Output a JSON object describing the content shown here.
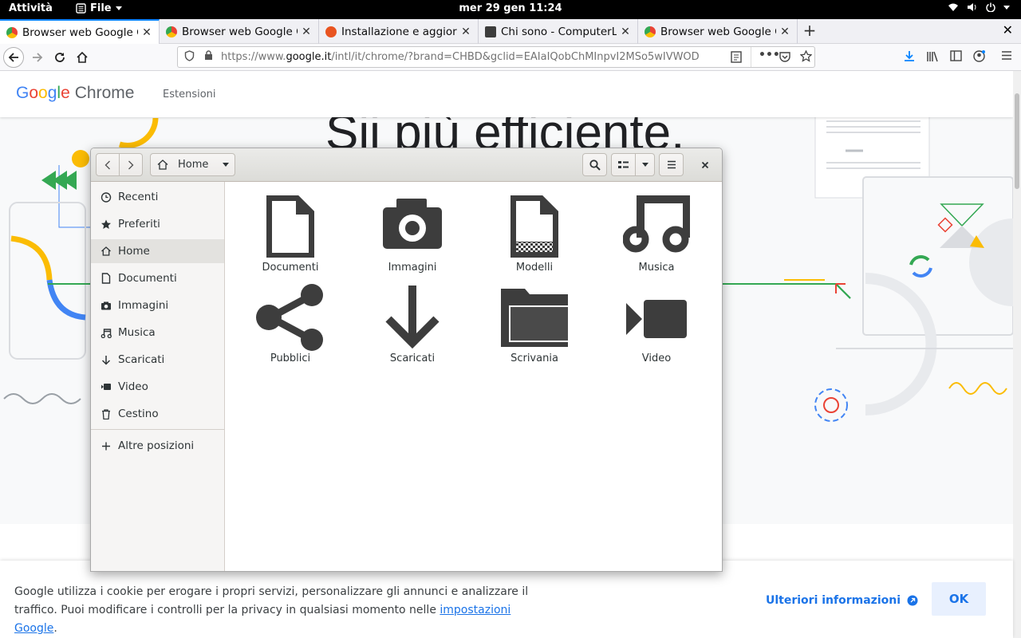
{
  "topbar": {
    "activities": "Attività",
    "app_menu": "File",
    "clock": "mer 29 gen 11:24"
  },
  "browser": {
    "tabs": [
      {
        "title": "Browser web Google C",
        "favicon": "chrome",
        "active": true
      },
      {
        "title": "Browser web Google C",
        "favicon": "chrome",
        "active": false
      },
      {
        "title": "Installazione e aggiorn",
        "favicon": "ubuntu",
        "active": false
      },
      {
        "title": "Chi sono - ComputerLe",
        "favicon": "page",
        "active": false
      },
      {
        "title": "Browser web Google C",
        "favicon": "chrome",
        "active": false
      }
    ],
    "url_prefix": "https://www.",
    "url_domain": "google.it",
    "url_rest": "/intl/it/chrome/?brand=CHBD&gclid=EAIaIQobChMInpvI2MSo5wIVWOD"
  },
  "page": {
    "logo_google": [
      "G",
      "o",
      "o",
      "g",
      "l",
      "e"
    ],
    "logo_chrome": "Chrome",
    "nav_extensions": "Estensioni",
    "hero_title": "Sii più efficiente."
  },
  "cookie": {
    "message": "Google utilizza i cookie per erogare i propri servizi, personalizzare gli annunci e analizzare il traffico. Puoi modificare i controlli per la privacy in qualsiasi momento nelle",
    "link": "impostazioni Google",
    "after_link": ".",
    "more": "Ulteriori informazioni",
    "ok": "OK"
  },
  "files": {
    "location": "Home",
    "sidebar": [
      {
        "label": "Recenti",
        "icon": "clock-icon",
        "selected": false
      },
      {
        "label": "Preferiti",
        "icon": "star-icon",
        "selected": false
      },
      {
        "label": "Home",
        "icon": "home-icon",
        "selected": true
      },
      {
        "label": "Documenti",
        "icon": "document-icon",
        "selected": false
      },
      {
        "label": "Immagini",
        "icon": "camera-icon",
        "selected": false
      },
      {
        "label": "Musica",
        "icon": "music-icon",
        "selected": false
      },
      {
        "label": "Scaricati",
        "icon": "download-icon",
        "selected": false
      },
      {
        "label": "Video",
        "icon": "video-icon",
        "selected": false
      },
      {
        "label": "Cestino",
        "icon": "trash-icon",
        "selected": false
      }
    ],
    "other_locations": "Altre posizioni",
    "folders": [
      {
        "label": "Documenti",
        "icon": "document-folder-icon"
      },
      {
        "label": "Immagini",
        "icon": "camera-folder-icon"
      },
      {
        "label": "Modelli",
        "icon": "template-folder-icon"
      },
      {
        "label": "Musica",
        "icon": "music-folder-icon"
      },
      {
        "label": "Pubblici",
        "icon": "share-folder-icon"
      },
      {
        "label": "Scaricati",
        "icon": "download-folder-icon"
      },
      {
        "label": "Scrivania",
        "icon": "desktop-folder-icon"
      },
      {
        "label": "Video",
        "icon": "video-folder-icon"
      }
    ]
  }
}
